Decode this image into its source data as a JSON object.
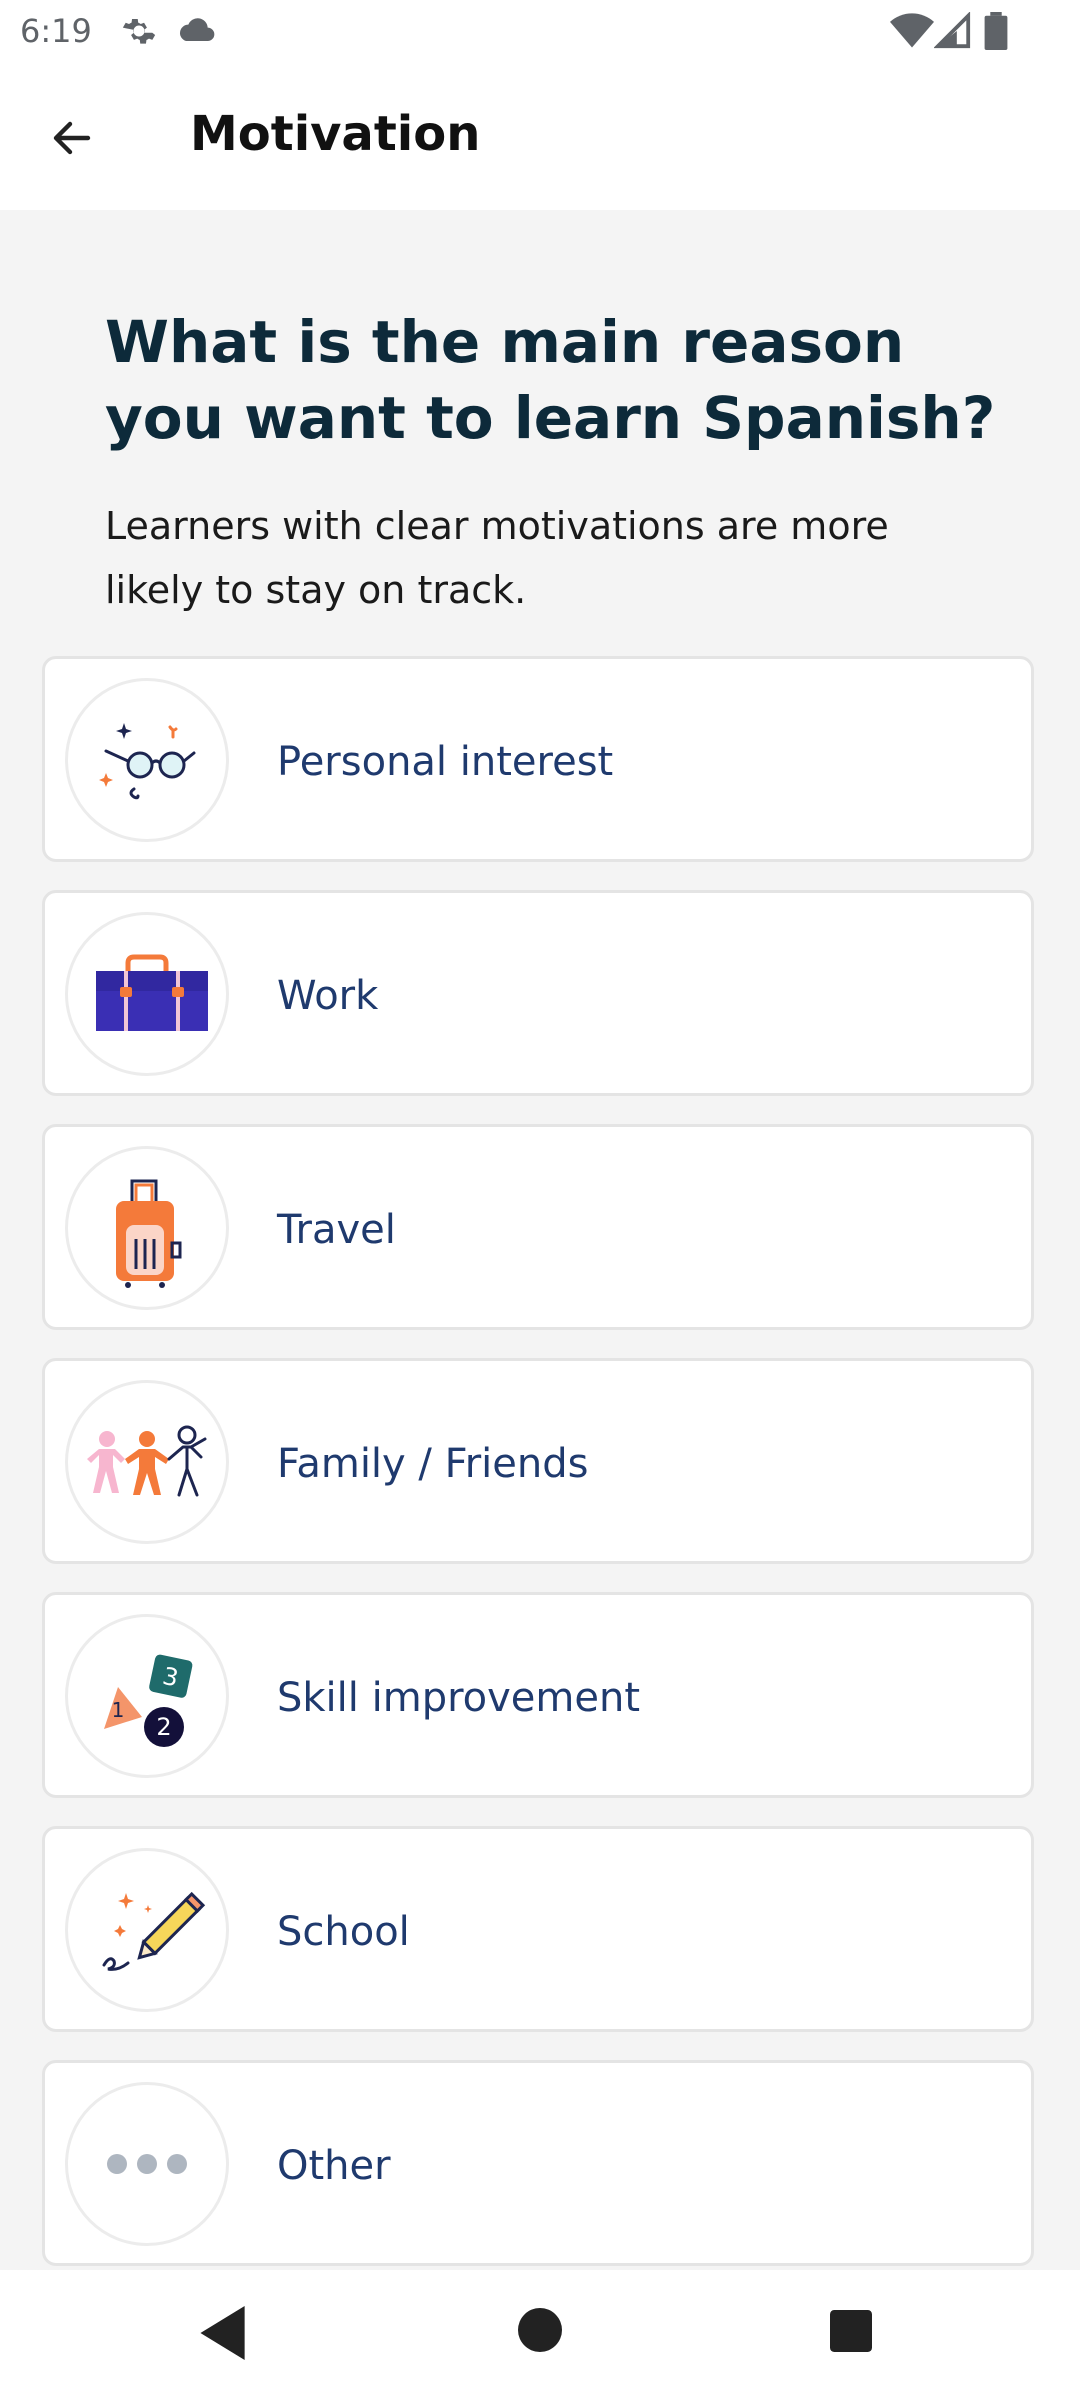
{
  "status": {
    "time": "6:19",
    "icons": [
      "gear-icon",
      "cloud-icon",
      "wifi-icon",
      "signal-icon",
      "battery-icon"
    ]
  },
  "app_bar": {
    "title": "Motivation",
    "back_icon": "arrow-left-icon"
  },
  "main": {
    "heading": "What is the main reason you want to learn Spanish?",
    "subtitle": "Learners with clear motivations are more likely to stay on track.",
    "options": [
      {
        "label": "Personal interest",
        "icon": "glasses-icon"
      },
      {
        "label": "Work",
        "icon": "briefcase-icon"
      },
      {
        "label": "Travel",
        "icon": "suitcase-icon"
      },
      {
        "label": "Family / Friends",
        "icon": "people-icon"
      },
      {
        "label": "Skill improvement",
        "icon": "shapes-icon",
        "icon_text": [
          "1",
          "2",
          "3"
        ]
      },
      {
        "label": "School",
        "icon": "pencil-icon"
      },
      {
        "label": "Other",
        "icon": "more-dots-icon"
      }
    ]
  },
  "nav": {
    "icons": [
      "nav-back-icon",
      "nav-home-icon",
      "nav-recents-icon"
    ]
  },
  "colors": {
    "heading": "#0d2a3a",
    "option_label": "#1f3a6e",
    "accent_orange": "#f47a3a",
    "accent_purple": "#3a2fb4",
    "background": "#f4f4f4"
  }
}
